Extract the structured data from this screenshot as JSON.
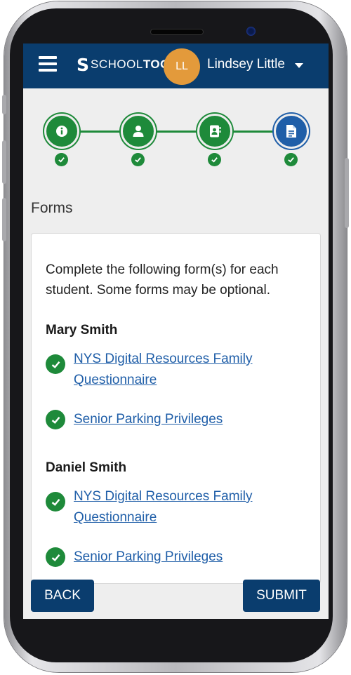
{
  "header": {
    "menu_icon": "hamburger-menu-icon",
    "logo_mark": "S",
    "logo_text_light": "SCHOOL",
    "logo_text_bold": "TOOL",
    "avatar_initials": "LL",
    "avatar_color": "#e39a3b",
    "user_name": "Lindsey Little",
    "background": "#0a3d6e"
  },
  "stepper": {
    "steps": [
      {
        "icon": "info-icon",
        "status": "complete"
      },
      {
        "icon": "person-icon",
        "status": "complete"
      },
      {
        "icon": "contact-book-icon",
        "status": "complete"
      },
      {
        "icon": "document-icon",
        "status": "active"
      }
    ],
    "complete_color": "#1e8a3a",
    "active_color": "#1f5ea8"
  },
  "section": {
    "title": "Forms"
  },
  "card": {
    "intro": "Complete the following form(s) for each student. Some forms may be optional.",
    "students": [
      {
        "name": "Mary Smith",
        "forms": [
          {
            "label": "NYS Digital Resources Family Questionnaire",
            "status": "complete"
          },
          {
            "label": "Senior Parking Privileges",
            "status": "complete"
          }
        ]
      },
      {
        "name": "Daniel Smith",
        "forms": [
          {
            "label": "NYS Digital Resources Family Questionnaire",
            "status": "complete"
          },
          {
            "label": "Senior Parking Privileges",
            "status": "complete"
          }
        ]
      }
    ]
  },
  "footer": {
    "back_label": "BACK",
    "submit_label": "SUBMIT"
  }
}
